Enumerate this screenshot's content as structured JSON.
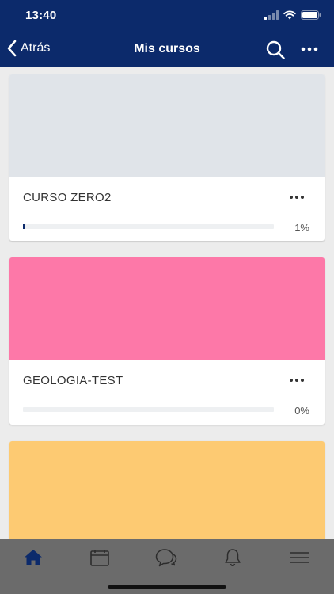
{
  "status_bar": {
    "time": "13:40",
    "icons": [
      "signal-icon",
      "wifi-icon",
      "battery-icon"
    ]
  },
  "nav": {
    "back_label": "Atrás",
    "title": "Mis cursos",
    "icons": [
      "chevron-left-icon",
      "search-icon",
      "more-horizontal-icon"
    ]
  },
  "courses": [
    {
      "name": "CURSO ZERO2",
      "progress_text": "1%",
      "progress": 0.01,
      "image_color": "#e0e4e9"
    },
    {
      "name": "GEOLOGIA-TEST",
      "progress_text": "0%",
      "progress": 0.0,
      "image_color": "#fd78a8"
    },
    {
      "image_color": "#fdca72"
    }
  ],
  "tab_bar": {
    "tabs": [
      "home-icon",
      "calendar-icon",
      "messages-icon",
      "notifications-icon",
      "menu-icon"
    ],
    "active": "home-icon"
  },
  "colors": {
    "primary": "#0c2a6b",
    "tab_bar": "#6b6b6b",
    "background": "#ececec"
  }
}
